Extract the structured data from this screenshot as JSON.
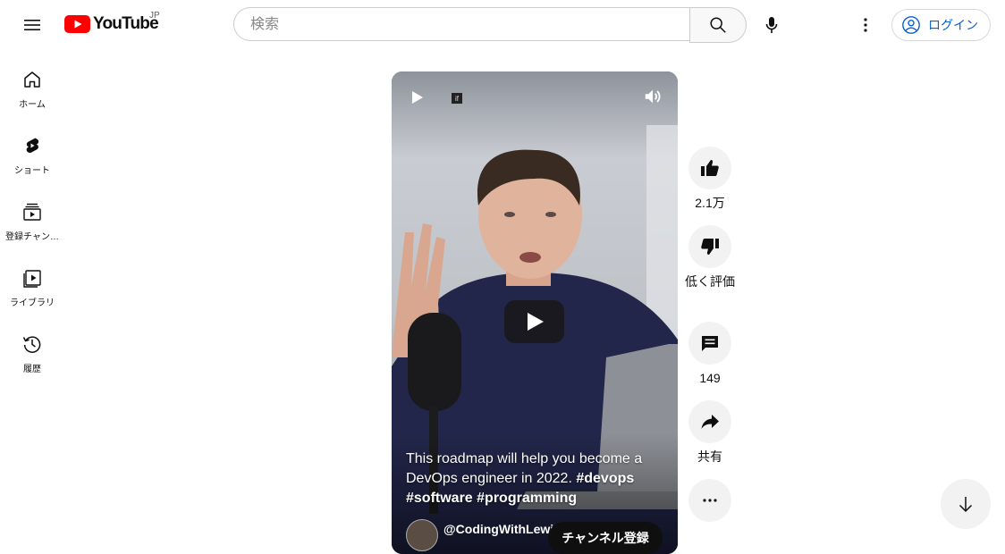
{
  "header": {
    "logo_text": "YouTube",
    "region": "JP",
    "search_placeholder": "検索",
    "login_label": "ログイン"
  },
  "sidebar": {
    "items": [
      {
        "label": "ホーム",
        "icon": "home-icon"
      },
      {
        "label": "ショート",
        "icon": "shorts-icon"
      },
      {
        "label": "登録チャン…",
        "icon": "subscriptions-icon"
      },
      {
        "label": "ライブラリ",
        "icon": "library-icon"
      },
      {
        "label": "履歴",
        "icon": "history-icon"
      }
    ]
  },
  "video": {
    "badge": "if",
    "caption_text": "This roadmap will help you become a DevOps engineer in 2022.",
    "hashtags": [
      "#devops",
      "#software",
      "#programming"
    ],
    "channel_handle": "@CodingWithLewi",
    "subscribe_label": "チャンネル登録"
  },
  "actions": {
    "like_count": "2.1万",
    "dislike_label": "低く評価",
    "comment_count": "149",
    "share_label": "共有"
  },
  "colors": {
    "brand_red": "#ff0000",
    "link_blue": "#065fd4",
    "rail_bg": "#f2f2f2"
  }
}
